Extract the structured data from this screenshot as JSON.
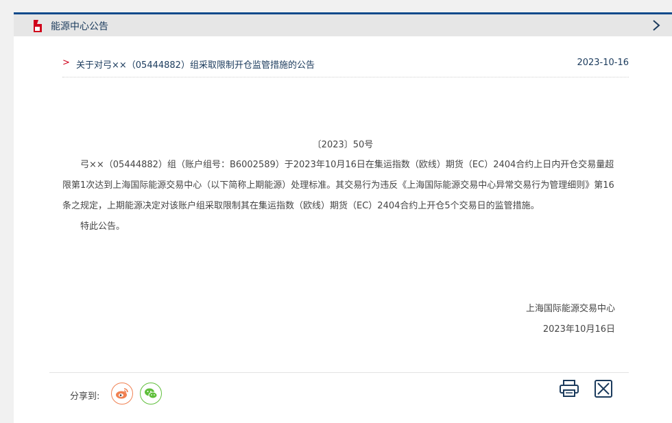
{
  "header": {
    "title": "能源中心公告",
    "chevron_icon": "chevron-right-icon"
  },
  "notice": {
    "arrow": ">",
    "title": "关于对弓××（05444882）组采取限制开仓监管措施的公告",
    "date": "2023-10-16"
  },
  "document": {
    "number": "〔2023〕50号",
    "paragraphs": [
      "弓××（05444882）组（账户组号：B6002589）于2023年10月16日在集运指数（欧线）期货（EC）2404合约上日内开仓交易量超限第1次达到上海国际能源交易中心（以下简称上期能源）处理标准。其交易行为违反《上海国际能源交易中心异常交易行为管理细则》第16条之规定，上期能源决定对该账户组采取限制其在集运指数（欧线）期货（EC）2404合约上开仓5个交易日的监管措施。",
      "特此公告。"
    ],
    "signer": "上海国际能源交易中心",
    "sign_date": "2023年10月16日"
  },
  "share": {
    "label": "分享到:",
    "weibo_icon": "weibo-icon",
    "wechat_icon": "wechat-icon"
  },
  "tools": {
    "print_icon": "printer-icon",
    "close_icon": "close-icon"
  },
  "colors": {
    "accent": "#0b4a8b",
    "arrow": "#d0021b",
    "weibo": "#f08152",
    "wechat": "#5fbf3b"
  }
}
